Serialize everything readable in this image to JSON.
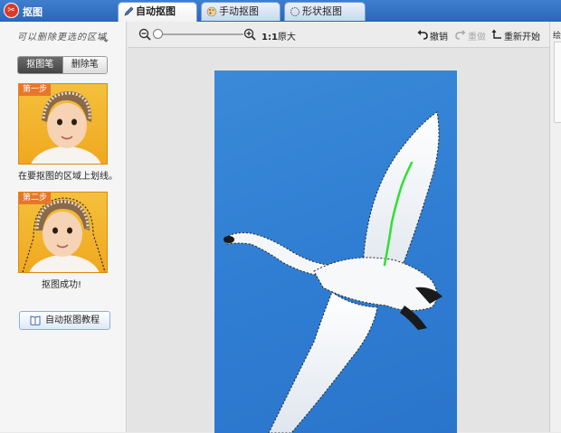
{
  "app": {
    "title": "抠图",
    "logo_glyph": "✂"
  },
  "tabs": [
    {
      "label": "自动抠图",
      "icon": "pen-icon",
      "active": true
    },
    {
      "label": "手动抠图",
      "icon": "palette-icon",
      "active": false
    },
    {
      "label": "形状抠图",
      "icon": "shape-icon",
      "active": false
    }
  ],
  "left_panel": {
    "hint": "可以删除更选的区域",
    "brush_tabs": [
      "抠图笔",
      "删除笔"
    ],
    "step1": {
      "badge": "第一步",
      "caption": "在要抠图的区域上划线。"
    },
    "step2": {
      "badge": "第二步",
      "caption": "抠图成功!"
    },
    "tutorial_button": "自动抠图教程"
  },
  "toolbar": {
    "zoom_level": 0.0,
    "zoom_ratio": "1:1",
    "zoom_label": "原大",
    "undo": "撤销",
    "redo": "重做",
    "reset": "重新开始"
  },
  "right_strip": {
    "label": "绘"
  },
  "colors": {
    "titlebar": "#2f6cc0",
    "photo_sky": "#2f7ed3",
    "stroke_green": "#2fe02f",
    "step_bg": "#f2b430"
  }
}
